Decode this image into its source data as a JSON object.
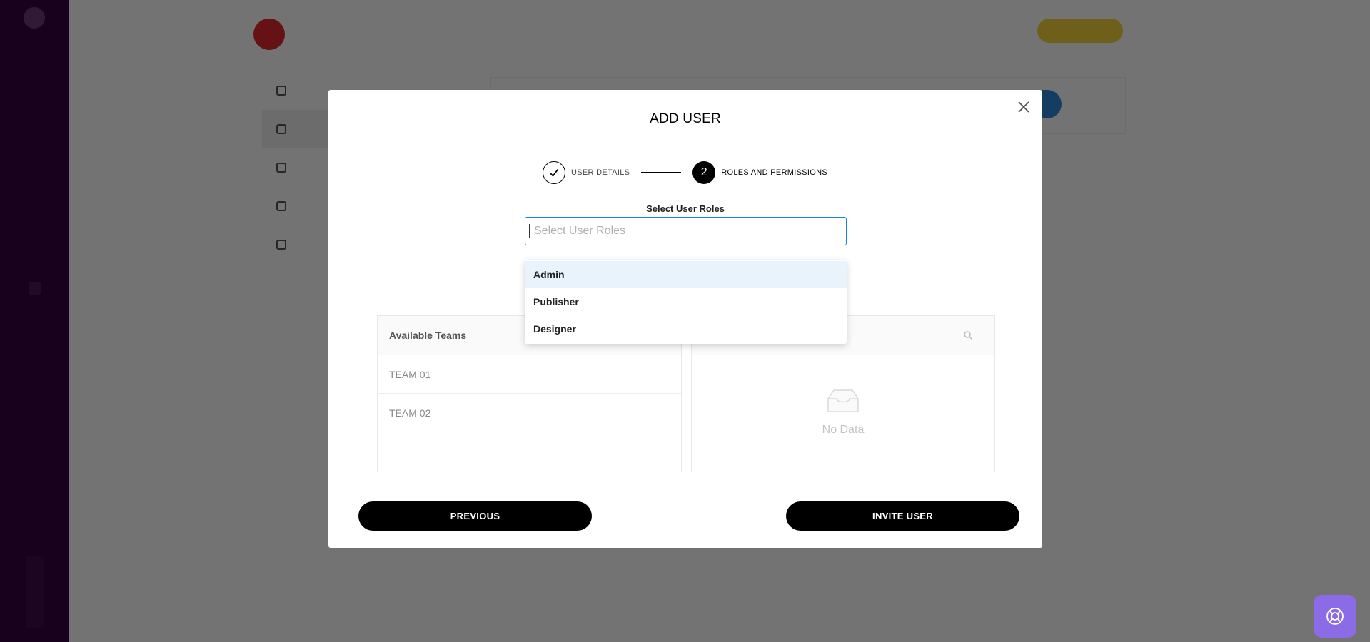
{
  "colors": {
    "sidebar": "#35043f",
    "overlay": "rgba(0,0,0,0.55)",
    "accent_blue": "#1a7df1",
    "help_button": "#8b6be6",
    "primary_button": "#000000"
  },
  "modal": {
    "title": "ADD USER",
    "close_icon": "close-icon",
    "steps": [
      {
        "label": "USER DETAILS",
        "state": "done",
        "marker": "✓"
      },
      {
        "label": "ROLES AND PERMISSIONS",
        "state": "current",
        "marker": "2"
      }
    ],
    "roles": {
      "label": "Select User Roles",
      "placeholder": "Select User Roles",
      "value": "",
      "options": [
        "Admin",
        "Publisher",
        "Designer"
      ],
      "highlighted_option": "Admin"
    },
    "teams": {
      "available_header": "Available Teams",
      "available": [
        "TEAM 01",
        "TEAM 02"
      ],
      "selected_empty_text": "No Data"
    },
    "buttons": {
      "previous": "PREVIOUS",
      "invite": "INVITE USER"
    }
  },
  "help": {
    "icon": "lifebuoy-icon"
  }
}
